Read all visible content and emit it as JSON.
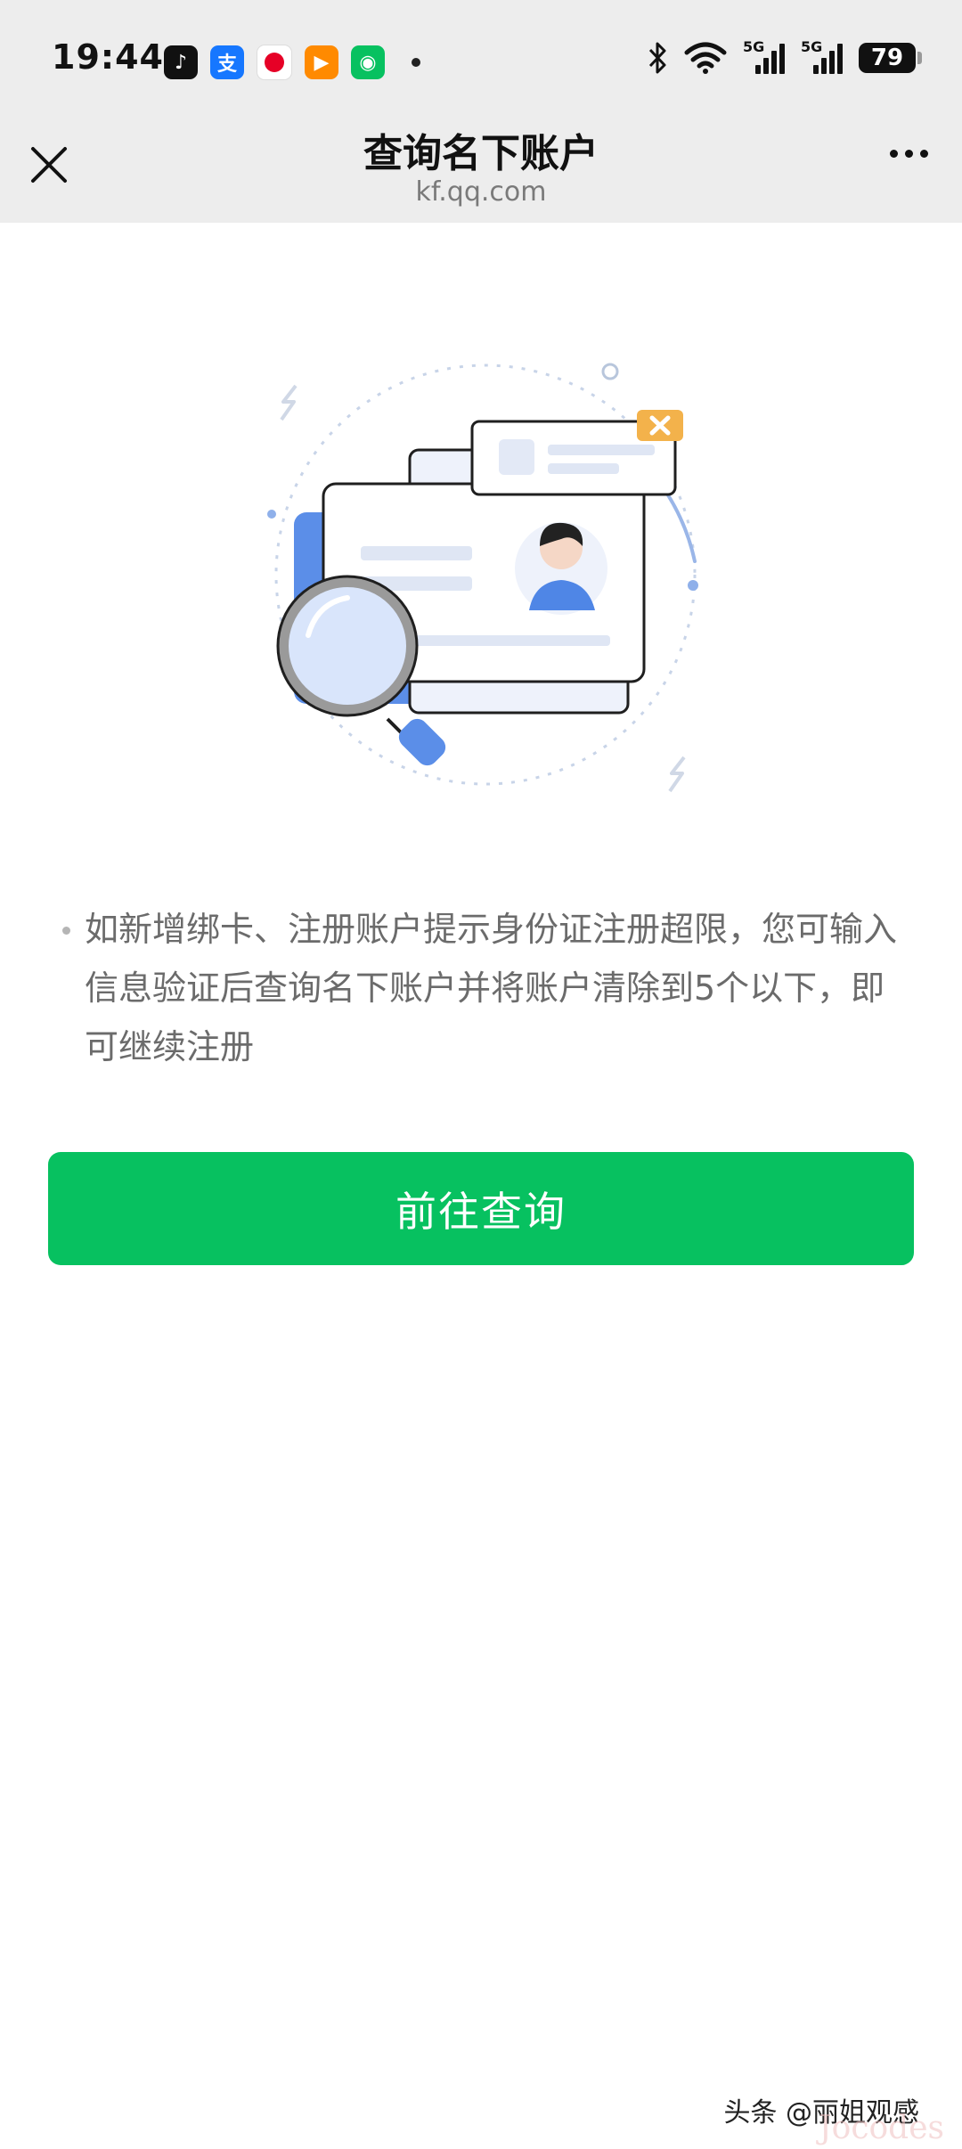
{
  "status_bar": {
    "time": "19:44",
    "network_1": "5G",
    "network_2": "5G",
    "battery": "79"
  },
  "nav": {
    "title": "查询名下账户",
    "subtitle": "kf.qq.com"
  },
  "illustration": {
    "icons": [
      "id-card-icon",
      "magnifier-icon",
      "user-avatar-icon",
      "close-badge-icon"
    ]
  },
  "content": {
    "info_text": "如新增绑卡、注册账户提示身份证注册超限，您可输入信息验证后查询名下账户并将账户清除到5个以下，即可继续注册",
    "button_label": "前往查询"
  },
  "watermark": {
    "text": "头条 @丽姐观感",
    "ghost": "Jocodes"
  },
  "colors": {
    "primary": "#07c160",
    "nav_bg": "#ededed",
    "accent_blue": "#5b8ee8",
    "badge_orange": "#f3b24b"
  }
}
